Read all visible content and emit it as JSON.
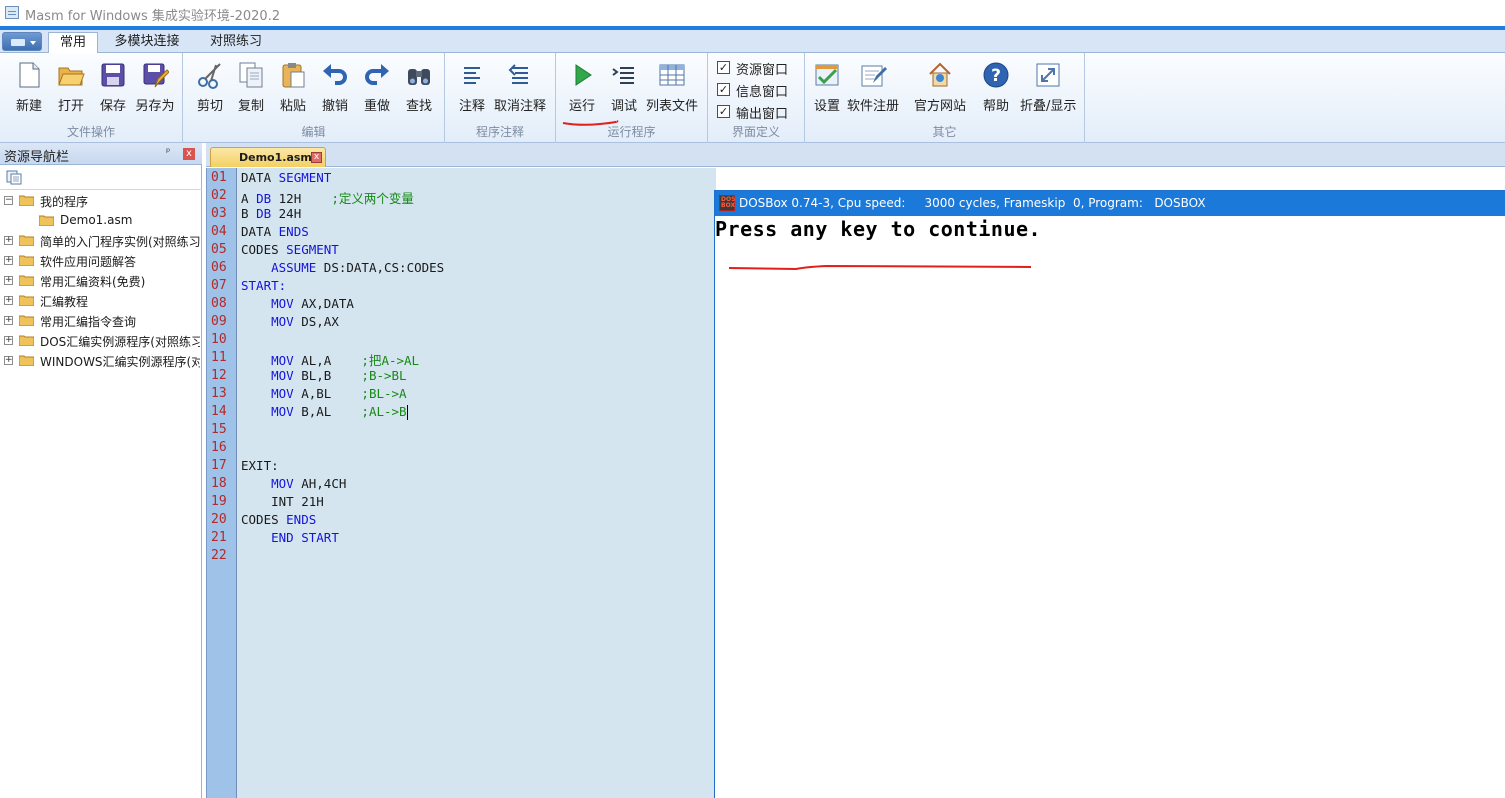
{
  "window": {
    "title": "Masm for Windows 集成实验环境-2020.2"
  },
  "ribbon": {
    "tabs": [
      "常用",
      "多模块连接",
      "对照练习"
    ],
    "groups": {
      "file": {
        "label": "文件操作",
        "buttons": [
          "新建",
          "打开",
          "保存",
          "另存为"
        ]
      },
      "edit": {
        "label": "编辑",
        "buttons": [
          "剪切",
          "复制",
          "粘贴",
          "撤销",
          "重做",
          "查找"
        ]
      },
      "comment": {
        "label": "程序注释",
        "buttons": [
          "注释",
          "取消注释"
        ]
      },
      "run": {
        "label": "运行程序",
        "buttons": [
          "运行",
          "调试",
          "列表文件"
        ]
      },
      "view": {
        "label": "界面定义",
        "checks": [
          "资源窗口",
          "信息窗口",
          "输出窗口"
        ]
      },
      "other": {
        "label": "其它",
        "buttons": [
          "设置",
          "软件注册",
          "官方网站",
          "帮助",
          "折叠/显示"
        ]
      }
    }
  },
  "navigator": {
    "title": "资源导航栏",
    "pin": "ᵖ",
    "close": "x",
    "tree": [
      {
        "label": "我的程序",
        "expanded": true
      },
      {
        "label": "Demo1.asm",
        "file": true
      },
      {
        "label": "简单的入门程序实例(对照练习)"
      },
      {
        "label": "软件应用问题解答"
      },
      {
        "label": "常用汇编资料(免费)"
      },
      {
        "label": "汇编教程"
      },
      {
        "label": "常用汇编指令查询"
      },
      {
        "label": "DOS汇编实例源程序(对照练习)"
      },
      {
        "label": "WINDOWS汇编实例源程序(对照)"
      }
    ]
  },
  "editor": {
    "tab": "Demo1.asm",
    "close": "x",
    "line_numbers": [
      "01",
      "02",
      "03",
      "04",
      "05",
      "06",
      "07",
      "08",
      "09",
      "10",
      "11",
      "12",
      "13",
      "14",
      "15",
      "16",
      "17",
      "18",
      "19",
      "20",
      "21",
      "22"
    ],
    "lines": [
      [
        {
          "t": "DATA ",
          "c": "cn"
        },
        {
          "t": "SEGMENT",
          "c": "kw"
        }
      ],
      [
        {
          "t": "A ",
          "c": "cn"
        },
        {
          "t": "DB",
          "c": "kw"
        },
        {
          "t": " 12H    ",
          "c": "cn"
        },
        {
          "t": ";定义两个变量",
          "c": "cm"
        }
      ],
      [
        {
          "t": "B ",
          "c": "cn"
        },
        {
          "t": "DB",
          "c": "kw"
        },
        {
          "t": " 24H",
          "c": "cn"
        }
      ],
      [
        {
          "t": "DATA ",
          "c": "cn"
        },
        {
          "t": "ENDS",
          "c": "kw"
        }
      ],
      [
        {
          "t": "CODES ",
          "c": "cn"
        },
        {
          "t": "SEGMENT",
          "c": "kw"
        }
      ],
      [
        {
          "t": "    ",
          "c": "cn"
        },
        {
          "t": "ASSUME",
          "c": "kw"
        },
        {
          "t": " DS:DATA,CS:CODES",
          "c": "cn"
        }
      ],
      [
        {
          "t": "START:",
          "c": "kw"
        }
      ],
      [
        {
          "t": "    ",
          "c": "cn"
        },
        {
          "t": "MOV",
          "c": "kw"
        },
        {
          "t": " AX,DATA",
          "c": "cn"
        }
      ],
      [
        {
          "t": "    ",
          "c": "cn"
        },
        {
          "t": "MOV",
          "c": "kw"
        },
        {
          "t": " DS,AX",
          "c": "cn"
        }
      ],
      [],
      [
        {
          "t": "    ",
          "c": "cn"
        },
        {
          "t": "MOV",
          "c": "kw"
        },
        {
          "t": " AL,A    ",
          "c": "cn"
        },
        {
          "t": ";把A->AL",
          "c": "cm"
        }
      ],
      [
        {
          "t": "    ",
          "c": "cn"
        },
        {
          "t": "MOV",
          "c": "kw"
        },
        {
          "t": " BL,B    ",
          "c": "cn"
        },
        {
          "t": ";B->BL",
          "c": "cm"
        }
      ],
      [
        {
          "t": "    ",
          "c": "cn"
        },
        {
          "t": "MOV",
          "c": "kw"
        },
        {
          "t": " A,BL    ",
          "c": "cn"
        },
        {
          "t": ";BL->A",
          "c": "cm"
        }
      ],
      [
        {
          "t": "    ",
          "c": "cn"
        },
        {
          "t": "MOV",
          "c": "kw"
        },
        {
          "t": " B,AL    ",
          "c": "cn"
        },
        {
          "t": ";AL->B",
          "c": "cm"
        }
      ],
      [],
      [],
      [
        {
          "t": "EXIT:",
          "c": "cn"
        }
      ],
      [
        {
          "t": "    ",
          "c": "cn"
        },
        {
          "t": "MOV",
          "c": "kw"
        },
        {
          "t": " AH,4CH",
          "c": "cn"
        }
      ],
      [
        {
          "t": "    ",
          "c": "cn"
        },
        {
          "t": "INT 21H",
          "c": "cn"
        }
      ],
      [
        {
          "t": "CODES ",
          "c": "cn"
        },
        {
          "t": "ENDS",
          "c": "kw"
        }
      ],
      [
        {
          "t": "    ",
          "c": "cn"
        },
        {
          "t": "END START",
          "c": "kw"
        }
      ],
      []
    ]
  },
  "dosbox": {
    "title": "DOSBox 0.74-3, Cpu speed:     3000 cycles, Frameskip  0, Program:   DOSBOX",
    "output": "Press any key to continue.",
    "icon_text": "DOS BOX"
  },
  "colors": {
    "accent": "#1f7fe0",
    "keyword": "#1414d8",
    "comment": "#148a14",
    "line_number": "#b32828",
    "annotation_ink": "#e0201b"
  }
}
